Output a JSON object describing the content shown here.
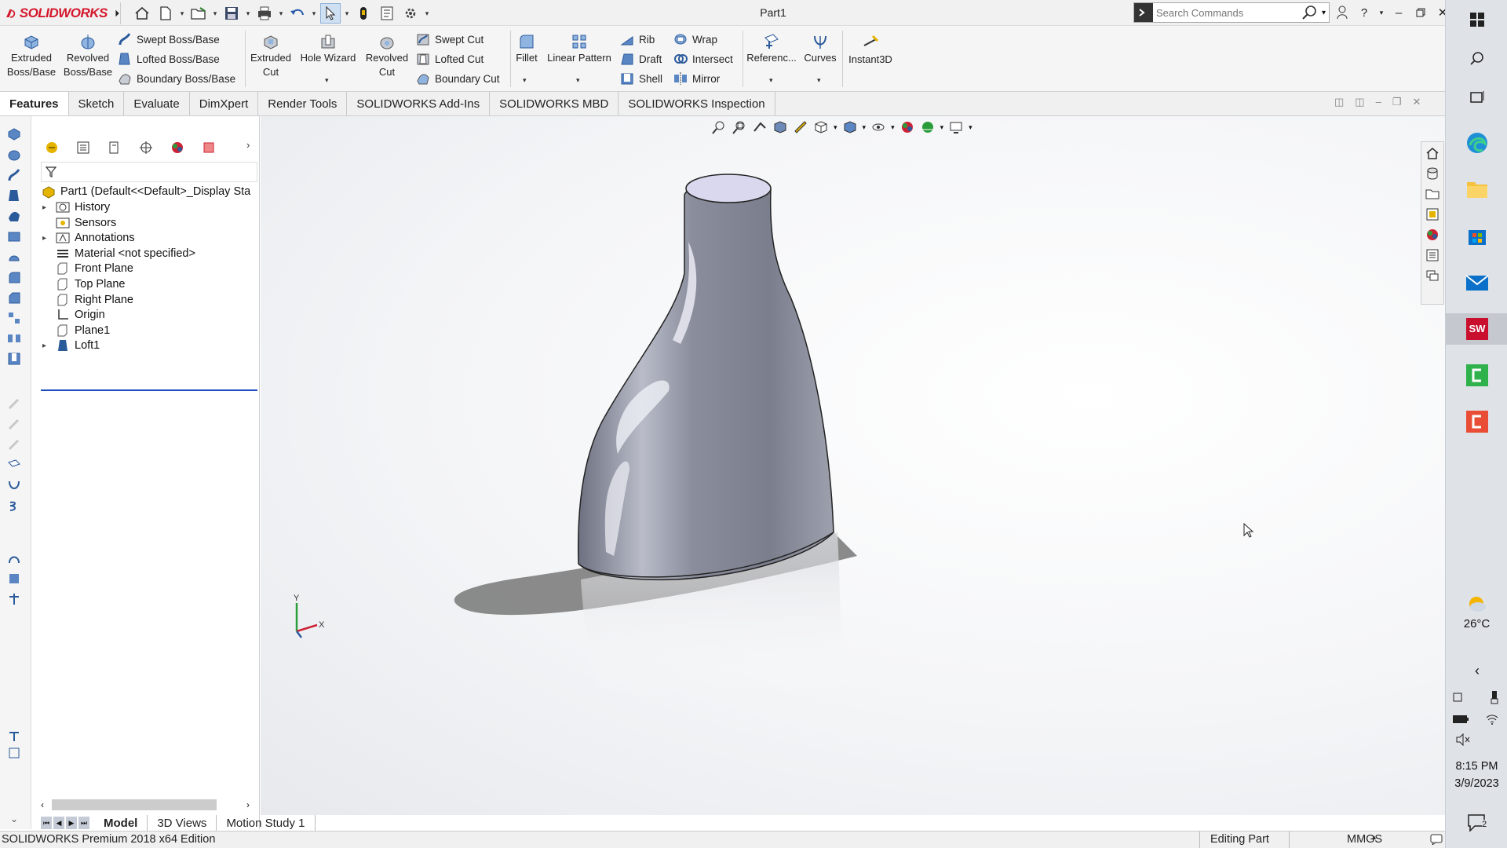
{
  "window": {
    "app_name": "SOLIDWORKS",
    "document_title": "Part1",
    "search_placeholder": "Search Commands"
  },
  "ribbon": {
    "big_buttons": [
      {
        "id": "extruded-boss",
        "label": "Extruded\nBoss/Base",
        "icon": "extrude-icon"
      },
      {
        "id": "revolved-boss",
        "label": "Revolved\nBoss/Base",
        "icon": "revolve-icon"
      },
      {
        "id": "extruded-cut",
        "label": "Extruded\nCut",
        "icon": "extruded-cut-icon"
      },
      {
        "id": "hole-wizard",
        "label": "Hole Wizard",
        "icon": "hole-wizard-icon"
      },
      {
        "id": "revolved-cut",
        "label": "Revolved\nCut",
        "icon": "revolved-cut-icon"
      },
      {
        "id": "fillet",
        "label": "Fillet",
        "icon": "fillet-icon"
      },
      {
        "id": "linear-pattern",
        "label": "Linear Pattern",
        "icon": "linear-pattern-icon"
      },
      {
        "id": "reference",
        "label": "Referenc...",
        "icon": "reference-geometry-icon"
      },
      {
        "id": "curves",
        "label": "Curves",
        "icon": "curves-icon"
      },
      {
        "id": "instant3d",
        "label": "Instant3D",
        "icon": "instant3d-icon"
      }
    ],
    "small_buttons": [
      {
        "id": "swept-boss",
        "label": "Swept Boss/Base"
      },
      {
        "id": "lofted-boss",
        "label": "Lofted Boss/Base"
      },
      {
        "id": "boundary-boss",
        "label": "Boundary Boss/Base"
      },
      {
        "id": "swept-cut",
        "label": "Swept Cut"
      },
      {
        "id": "lofted-cut",
        "label": "Lofted Cut"
      },
      {
        "id": "boundary-cut",
        "label": "Boundary Cut"
      },
      {
        "id": "rib",
        "label": "Rib"
      },
      {
        "id": "draft",
        "label": "Draft"
      },
      {
        "id": "shell",
        "label": "Shell"
      },
      {
        "id": "wrap",
        "label": "Wrap"
      },
      {
        "id": "intersect",
        "label": "Intersect"
      },
      {
        "id": "mirror",
        "label": "Mirror"
      }
    ]
  },
  "tabs": [
    "Features",
    "Sketch",
    "Evaluate",
    "DimXpert",
    "Render Tools",
    "SOLIDWORKS Add-Ins",
    "SOLIDWORKS MBD",
    "SOLIDWORKS Inspection"
  ],
  "active_tab": "Features",
  "feature_tree": {
    "root": "Part1  (Default<<Default>_Display Sta",
    "items": [
      {
        "label": "History",
        "expandable": true,
        "icon": "history-folder-icon"
      },
      {
        "label": "Sensors",
        "expandable": false,
        "icon": "sensors-icon"
      },
      {
        "label": "Annotations",
        "expandable": true,
        "icon": "annotations-icon"
      },
      {
        "label": "Material <not specified>",
        "expandable": false,
        "icon": "material-icon"
      },
      {
        "label": "Front Plane",
        "expandable": false,
        "icon": "plane-icon"
      },
      {
        "label": "Top Plane",
        "expandable": false,
        "icon": "plane-icon"
      },
      {
        "label": "Right Plane",
        "expandable": false,
        "icon": "plane-icon"
      },
      {
        "label": "Origin",
        "expandable": false,
        "icon": "origin-icon"
      },
      {
        "label": "Plane1",
        "expandable": false,
        "icon": "plane-icon"
      },
      {
        "label": "Loft1",
        "expandable": true,
        "icon": "loft-icon"
      }
    ]
  },
  "bottom_tabs": [
    "Model",
    "3D Views",
    "Motion Study 1"
  ],
  "active_bottom_tab": "Model",
  "triad_labels": {
    "y": "Y",
    "x": "X"
  },
  "status": {
    "edition": "SOLIDWORKS Premium 2018 x64 Edition",
    "mode": "Editing Part",
    "units": "MMGS"
  },
  "system_tray": {
    "temperature": "26°C",
    "time": "8:15 PM",
    "date": "3/9/2023",
    "notification_count": "2"
  },
  "colors": {
    "brand_red": "#d4182b",
    "ribbon_bg": "#f5f5f5",
    "part_gray": "#8a8d98",
    "selection_blue": "#1f4fbf"
  }
}
